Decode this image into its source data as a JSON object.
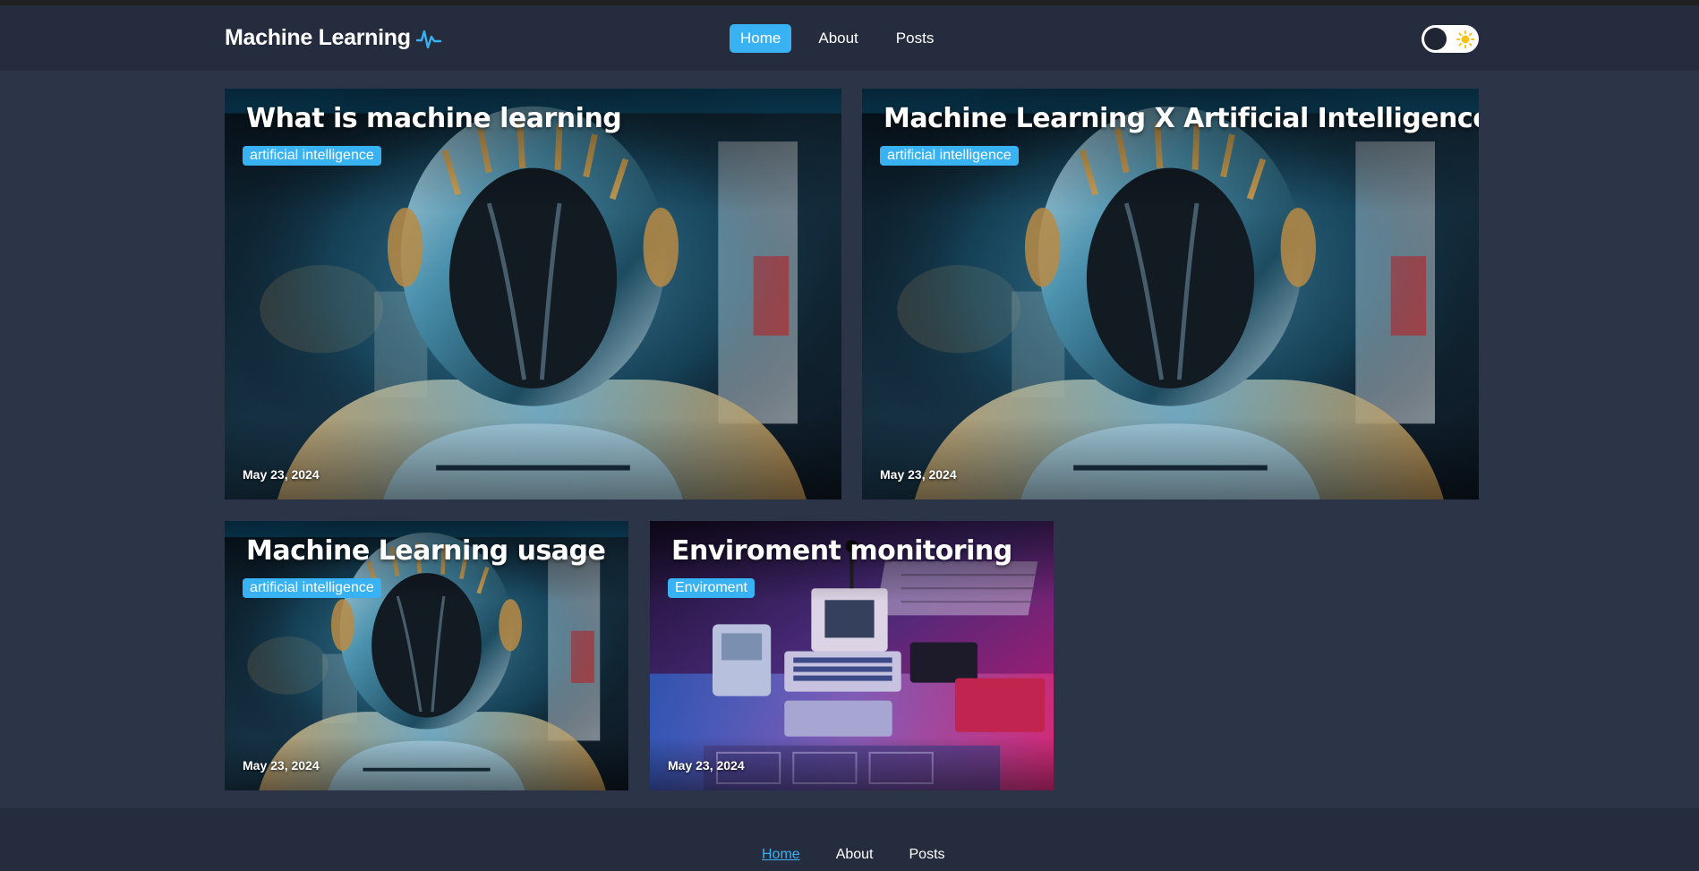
{
  "header": {
    "brand": "Machine Learning",
    "brand_icon": "pulse-icon",
    "nav": [
      {
        "label": "Home",
        "active": true
      },
      {
        "label": "About",
        "active": false
      },
      {
        "label": "Posts",
        "active": false
      }
    ],
    "theme_toggle_icon": "sun-icon"
  },
  "posts": [
    {
      "title": "What is machine learning",
      "tag": "artificial intelligence",
      "date": "May 23, 2024",
      "image": "robot-helmet-image"
    },
    {
      "title": "Machine Learning X Artificial Intelligence",
      "tag": "artificial intelligence",
      "date": "May 23, 2024",
      "image": "robot-helmet-image"
    },
    {
      "title": "Machine Learning usage",
      "tag": "artificial intelligence",
      "date": "May 23, 2024",
      "image": "robot-helmet-image"
    },
    {
      "title": "Enviroment monitoring",
      "tag": "Enviroment",
      "date": "May 23, 2024",
      "image": "retro-computers-image"
    }
  ],
  "footer": {
    "nav": [
      {
        "label": "Home",
        "active": true
      },
      {
        "label": "About",
        "active": false
      },
      {
        "label": "Posts",
        "active": false
      }
    ]
  },
  "colors": {
    "accent": "#38b2f3",
    "page_bg": "#2c3447",
    "header_bg": "#252c3d"
  }
}
